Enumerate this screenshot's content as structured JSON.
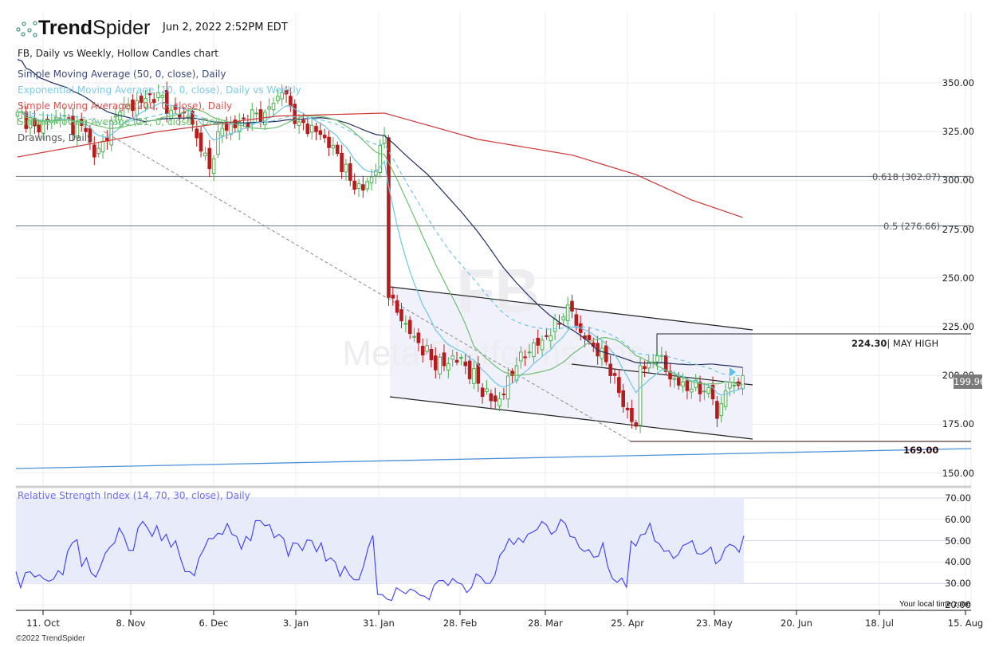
{
  "header": {
    "brand_bold": "Trend",
    "brand_light": "Spider",
    "timestamp": "Jun 2, 2022 2:52PM EDT"
  },
  "legend": [
    {
      "text": "FB, Daily vs Weekly, Hollow Candles chart",
      "color": "#222222"
    },
    {
      "text": "Simple Moving Average (50, 0, close), Daily",
      "color": "#3b4a78"
    },
    {
      "text": "Exponential Moving Average (10, 0, close), Daily vs Weekly",
      "color": "#7ccbe6"
    },
    {
      "text": "Simple Moving Average (200, 0, close), Daily",
      "color": "#d9534f"
    },
    {
      "text": "Simple Moving Average (21, 0, close), Daily",
      "color": "#6cbf6c"
    },
    {
      "text": "Drawings, Daily",
      "color": "#555555"
    }
  ],
  "watermark": {
    "symbol": "FB",
    "name": "Meta Platforms, Inc."
  },
  "last_price": "199.96",
  "annotations": {
    "fib_618": "0.618 (302.07)",
    "fib_50": "0.5 (276.66)",
    "may_high_value": "224.30",
    "may_high_label": "| MAY HIGH",
    "support": "169.00"
  },
  "price_axis": [
    "350.00",
    "325.00",
    "300.00",
    "275.00",
    "250.00",
    "225.00",
    "200.00",
    "175.00",
    "150.00"
  ],
  "rsi_axis": [
    "70.00",
    "60.00",
    "50.00",
    "40.00",
    "30.00",
    "20.00"
  ],
  "rsi_title": "Relative Strength Index (14, 70, 30, close), Daily",
  "x_axis": [
    "11. Oct",
    "8. Nov",
    "6. Dec",
    "3. Jan",
    "31. Jan",
    "28. Feb",
    "28. Mar",
    "25. Apr",
    "23. May",
    "20. Jun",
    "18. Jul",
    "15. Aug"
  ],
  "footer": {
    "copyright": "©2022 TrendSpider",
    "timezone": "Your local time zone"
  },
  "colors": {
    "up": "#4caf50",
    "down": "#b71c1c",
    "sma50": "#1f2d5c",
    "ema10": "#6ec6e6",
    "sma200": "#cc3333",
    "sma21": "#6cbf6c",
    "rsi": "#3b3bf5",
    "trendline": "#4a90d9"
  },
  "chart_data": {
    "type": "candlestick",
    "symbol": "FB",
    "interval": "Daily",
    "y_range": [
      140,
      360
    ],
    "close_anchors": [
      [
        0,
        335
      ],
      [
        4,
        328
      ],
      [
        10,
        332
      ],
      [
        16,
        325
      ],
      [
        18,
        312
      ],
      [
        20,
        320
      ],
      [
        24,
        335
      ],
      [
        30,
        342
      ],
      [
        33,
        345
      ],
      [
        36,
        336
      ],
      [
        40,
        333
      ],
      [
        43,
        315
      ],
      [
        45,
        306
      ],
      [
        47,
        325
      ],
      [
        52,
        330
      ],
      [
        58,
        335
      ],
      [
        62,
        345
      ],
      [
        66,
        330
      ],
      [
        70,
        325
      ],
      [
        74,
        318
      ],
      [
        78,
        300
      ],
      [
        81,
        295
      ],
      [
        84,
        305
      ],
      [
        86,
        323
      ],
      [
        87,
        240
      ],
      [
        90,
        228
      ],
      [
        93,
        220
      ],
      [
        97,
        208
      ],
      [
        100,
        205
      ],
      [
        102,
        210
      ],
      [
        105,
        205
      ],
      [
        108,
        196
      ],
      [
        111,
        187
      ],
      [
        113,
        188
      ],
      [
        117,
        205
      ],
      [
        120,
        212
      ],
      [
        124,
        220
      ],
      [
        128,
        230
      ],
      [
        130,
        233
      ],
      [
        132,
        222
      ],
      [
        135,
        215
      ],
      [
        138,
        207
      ],
      [
        140,
        200
      ],
      [
        142,
        184
      ],
      [
        145,
        174
      ],
      [
        146,
        205
      ],
      [
        148,
        207
      ],
      [
        150,
        210
      ],
      [
        152,
        202
      ],
      [
        155,
        195
      ],
      [
        158,
        193
      ],
      [
        161,
        192
      ],
      [
        163,
        188
      ],
      [
        164,
        178
      ],
      [
        166,
        192
      ],
      [
        168,
        195
      ],
      [
        170,
        199.96
      ]
    ],
    "sma200_anchors": [
      [
        0,
        312
      ],
      [
        33,
        325
      ],
      [
        61,
        333
      ],
      [
        86,
        334.5
      ],
      [
        108,
        321
      ],
      [
        130,
        313
      ],
      [
        145,
        303
      ],
      [
        158,
        290
      ],
      [
        170,
        281
      ]
    ],
    "fib_levels": [
      302.07,
      276.66
    ],
    "may_high": 224.3,
    "support_level": 169.0,
    "rsi": {
      "period": 14,
      "overbought": 70,
      "oversold": 30,
      "range": [
        20,
        75
      ],
      "values": [
        35.5,
        28,
        35,
        35.5,
        33,
        34,
        32,
        31,
        32,
        36,
        34,
        45,
        49,
        50.5,
        38,
        42,
        35,
        33,
        38,
        44,
        47,
        49,
        56,
        52,
        45.5,
        45.5,
        56,
        59,
        56,
        52,
        57,
        50,
        53,
        47,
        50,
        42,
        35.5,
        35.5,
        33.6,
        42,
        46,
        51,
        51,
        53.5,
        53,
        58,
        53,
        52,
        46,
        52,
        50,
        59.4,
        59.4,
        57,
        57.5,
        51.4,
        53,
        51,
        42.7,
        49,
        48.7,
        45.4,
        50.4,
        50,
        44.8,
        49,
        40.5,
        42,
        40,
        33.3,
        38,
        34,
        31.7,
        31.7,
        38,
        46.7,
        52.5,
        24.9,
        24.7,
        22.7,
        22,
        28,
        26.5,
        25.2,
        27.4,
        26.4,
        24.5,
        24,
        22.4,
        29,
        31.3,
        31.4,
        29,
        32.3,
        30.4,
        29.6,
        25.7,
        28,
        34.5,
        33,
        30,
        30.1,
        34,
        43,
        45.8,
        51,
        48.2,
        51.3,
        49.2,
        53,
        54,
        55.4,
        59,
        57.3,
        53,
        54.7,
        60,
        58,
        52,
        51.5,
        46.7,
        45,
        45.8,
        42.3,
        42.7,
        49,
        38,
        32.3,
        30.5,
        32.5,
        28.2,
        49.8,
        47.5,
        52.7,
        53.2,
        58.2,
        50,
        48.5,
        45,
        45.4,
        41.7,
        43.4,
        47.7,
        48.7,
        50,
        44,
        43.7,
        45,
        47,
        39.2,
        41,
        46.5,
        48.3,
        47.4,
        44.6,
        52.3
      ]
    }
  }
}
